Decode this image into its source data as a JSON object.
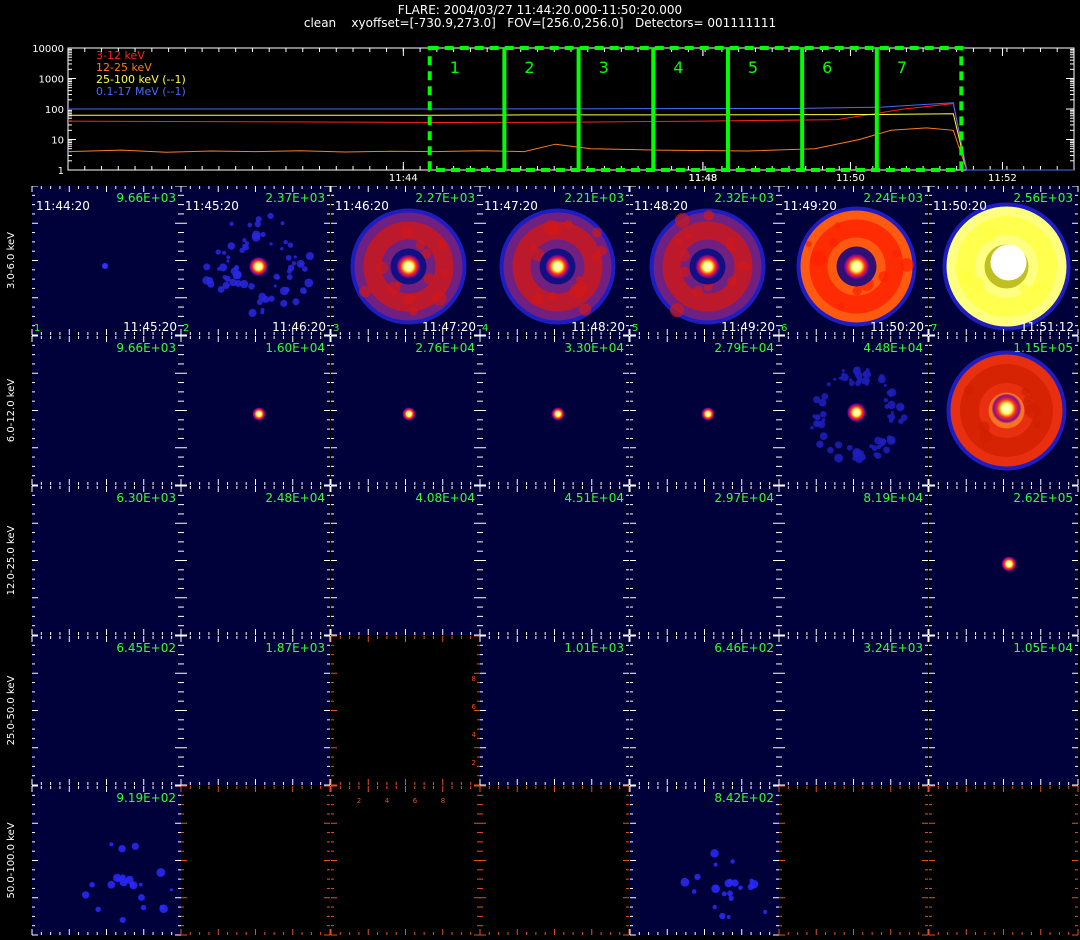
{
  "header": {
    "title": "FLARE: 2004/03/27 11:44:20.000-11:50:20.000",
    "subtitle": "clean    xyoffset=[-730.9,273.0]   FOV=[256.0,256.0]   Detectors= 001111111"
  },
  "colors": {
    "background": "#000000",
    "panel": "#00003a",
    "axis": "#ffffff",
    "label_green": "#33ff33",
    "interval_green": "#00ff00",
    "red_axis": "#e85020",
    "s_3_12": "#ff2020",
    "s_12_25": "#ff7a20",
    "s_25_100": "#ffff40",
    "s_01_17": "#4a6aff"
  },
  "chart_data": [
    {
      "type": "line",
      "scale": "log",
      "xticklabels": [
        "11:44",
        "11:48",
        "11:48",
        "11:50",
        "11:52"
      ],
      "xticks": [
        11.733,
        11.8,
        11.8,
        11.833,
        11.867
      ],
      "xlim": [
        11.658,
        11.883
      ],
      "yticklabels": [
        "1",
        "10",
        "100",
        "1000",
        "10000"
      ],
      "ylim": [
        1,
        10000
      ],
      "legend": [
        {
          "name": "3-12 keV",
          "color": "#ff2020"
        },
        {
          "name": "12-25 keV",
          "color": "#ff7a20"
        },
        {
          "name": "25-100 keV (--1)",
          "color": "#ffff40"
        },
        {
          "name": "0.1-17 MeV (--1)",
          "color": "#4a6aff"
        }
      ],
      "legend_placement": "top-left",
      "intervals": [
        {
          "label": "1",
          "start": 11.7389,
          "end": 11.7556
        },
        {
          "label": "2",
          "start": 11.7556,
          "end": 11.7722
        },
        {
          "label": "3",
          "start": 11.7722,
          "end": 11.7889
        },
        {
          "label": "4",
          "start": 11.7889,
          "end": 11.8056
        },
        {
          "label": "5",
          "start": 11.8056,
          "end": 11.8222
        },
        {
          "label": "6",
          "start": 11.8222,
          "end": 11.8389
        },
        {
          "label": "7",
          "start": 11.8389,
          "end": 11.8578
        }
      ],
      "series": [
        {
          "name": "3-12 keV",
          "color": "#ff2020",
          "x": [
            11.658,
            11.7,
            11.74,
            11.77,
            11.8,
            11.83,
            11.845,
            11.856,
            11.859,
            11.883
          ],
          "y": [
            40,
            38,
            36,
            37,
            40,
            45,
            100,
            150,
            1,
            1
          ]
        },
        {
          "name": "12-25 keV",
          "color": "#ff7a20",
          "x": [
            11.658,
            11.67,
            11.68,
            11.69,
            11.7,
            11.71,
            11.72,
            11.73,
            11.74,
            11.75,
            11.76,
            11.767,
            11.775,
            11.79,
            11.81,
            11.825,
            11.835,
            11.842,
            11.85,
            11.856,
            11.859,
            11.883
          ],
          "y": [
            4,
            4.5,
            3.8,
            4.2,
            4,
            4.3,
            3.9,
            4.1,
            4,
            4.3,
            4,
            7,
            5,
            4.5,
            4.2,
            5,
            10,
            20,
            24,
            20,
            1,
            1
          ]
        },
        {
          "name": "25-100 keV (--1)",
          "color": "#ffff40",
          "x": [
            11.658,
            11.74,
            11.76,
            11.8,
            11.84,
            11.856,
            11.859,
            11.883
          ],
          "y": [
            62,
            62,
            64,
            64,
            66,
            70,
            1,
            1
          ]
        },
        {
          "name": "0.1-17 MeV (--1)",
          "color": "#4a6aff",
          "x": [
            11.658,
            11.74,
            11.78,
            11.82,
            11.84,
            11.856,
            11.859,
            11.883
          ],
          "y": [
            100,
            100,
            102,
            104,
            115,
            160,
            1,
            1
          ]
        }
      ]
    },
    {
      "type": "heatmap",
      "row_labels": [
        "3.0-6.0 keV",
        "6.0-12.0 keV",
        "12.0-25.0 keV",
        "25.0-50.0 keV",
        "50.0-100.0 keV"
      ],
      "interval_labels": [
        "1",
        "2",
        "3",
        "4",
        "5",
        "6",
        "7"
      ],
      "start_times": [
        "11:44:20",
        "11:45:20",
        "11:46:20",
        "11:47:20",
        "11:48:20",
        "11:49:20",
        "11:50:20"
      ],
      "end_times": [
        "11:45:20",
        "11:46:20",
        "11:47:20",
        "11:48:20",
        "11:49:20",
        "11:50:20",
        "11:51:12"
      ],
      "peak_values": [
        [
          "9.66E+03",
          "2.37E+03",
          "2.27E+03",
          "2.21E+03",
          "2.32E+03",
          "2.24E+03",
          "2.56E+03"
        ],
        [
          "9.66E+03",
          "1.60E+04",
          "2.76E+04",
          "3.30E+04",
          "2.79E+04",
          "4.48E+04",
          "1.15E+05"
        ],
        [
          "6.30E+03",
          "2.48E+04",
          "4.08E+04",
          "4.51E+04",
          "2.97E+04",
          "8.19E+04",
          "2.62E+05"
        ],
        [
          "6.45E+02",
          "1.87E+03",
          "",
          "1.01E+03",
          "6.46E+02",
          "3.24E+03",
          "1.05E+04"
        ],
        [
          "9.19E+02",
          "",
          "",
          "",
          "8.42E+02",
          "",
          ""
        ]
      ],
      "empty_axis_ticklabels": [
        "2",
        "4",
        "6",
        "8"
      ]
    }
  ]
}
